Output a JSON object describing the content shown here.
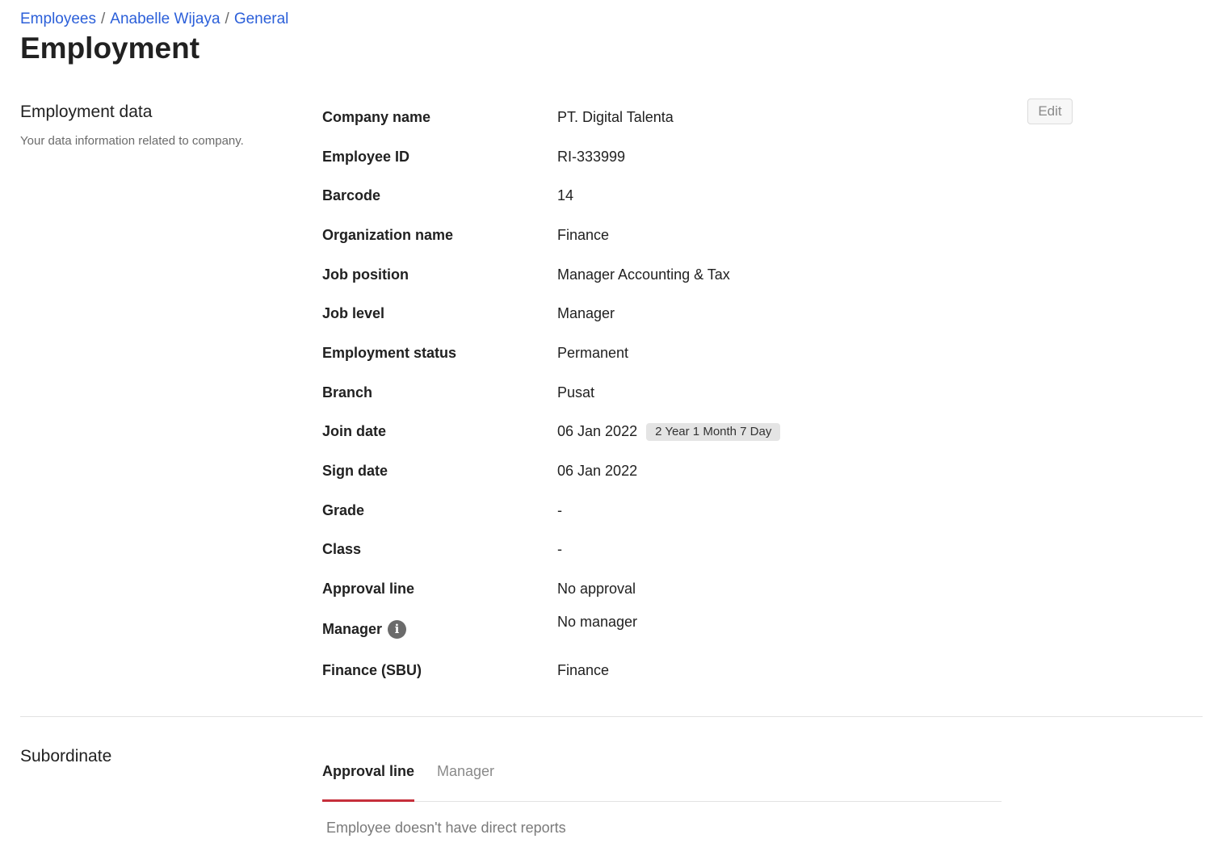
{
  "breadcrumb": {
    "items": [
      "Employees",
      "Anabelle Wijaya",
      "General"
    ],
    "separator": "/"
  },
  "page": {
    "title": "Employment"
  },
  "employment_section": {
    "title": "Employment data",
    "description": "Your data information related to company.",
    "edit_label": "Edit",
    "fields": [
      {
        "label": "Company name",
        "value": "PT. Digital Talenta"
      },
      {
        "label": "Employee ID",
        "value": "RI-333999"
      },
      {
        "label": "Barcode",
        "value": "14"
      },
      {
        "label": "Organization name",
        "value": "Finance"
      },
      {
        "label": "Job position",
        "value": "Manager Accounting & Tax"
      },
      {
        "label": "Job level",
        "value": "Manager"
      },
      {
        "label": "Employment status",
        "value": "Permanent"
      },
      {
        "label": "Branch",
        "value": "Pusat"
      },
      {
        "label": "Join date",
        "value": "06 Jan 2022",
        "badge": "2 Year 1 Month 7 Day"
      },
      {
        "label": "Sign date",
        "value": "06 Jan 2022"
      },
      {
        "label": "Grade",
        "value": "-"
      },
      {
        "label": "Class",
        "value": "-"
      },
      {
        "label": "Approval line",
        "value": "No approval"
      },
      {
        "label": "Manager",
        "value": "No manager",
        "info_icon": "info-icon",
        "info_glyph": "i"
      },
      {
        "label": "Finance (SBU)",
        "value": "Finance"
      }
    ]
  },
  "subordinate_section": {
    "title": "Subordinate",
    "tabs": [
      {
        "label": "Approval line",
        "active": true
      },
      {
        "label": "Manager",
        "active": false
      }
    ],
    "empty_message": "Employee doesn't have direct reports"
  },
  "colors": {
    "link": "#2b5fd9",
    "active_tab_underline": "#c62f3b",
    "badge_bg": "#e4e4e4"
  }
}
